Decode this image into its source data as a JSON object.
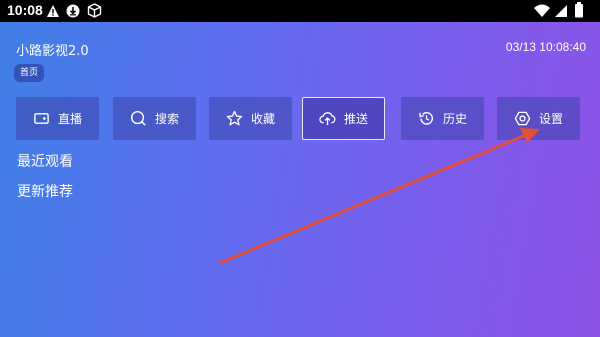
{
  "status": {
    "time": "10:08"
  },
  "app": {
    "title": "小路影视2.0",
    "clock": "03/13 10:08:40",
    "home_tab": "首页"
  },
  "nav": [
    {
      "label": "直播",
      "icon": "camera-icon"
    },
    {
      "label": "搜索",
      "icon": "search-icon"
    },
    {
      "label": "收藏",
      "icon": "star-icon"
    },
    {
      "label": "推送",
      "icon": "cloud-upload-icon"
    },
    {
      "label": "历史",
      "icon": "history-icon"
    },
    {
      "label": "设置",
      "icon": "settings-icon"
    }
  ],
  "sections": {
    "recent": "最近观看",
    "recommend": "更新推荐"
  },
  "colors": {
    "arrow": "#e0503d",
    "gradient_start": "#3f7fe6",
    "gradient_end": "#8c52e6"
  }
}
